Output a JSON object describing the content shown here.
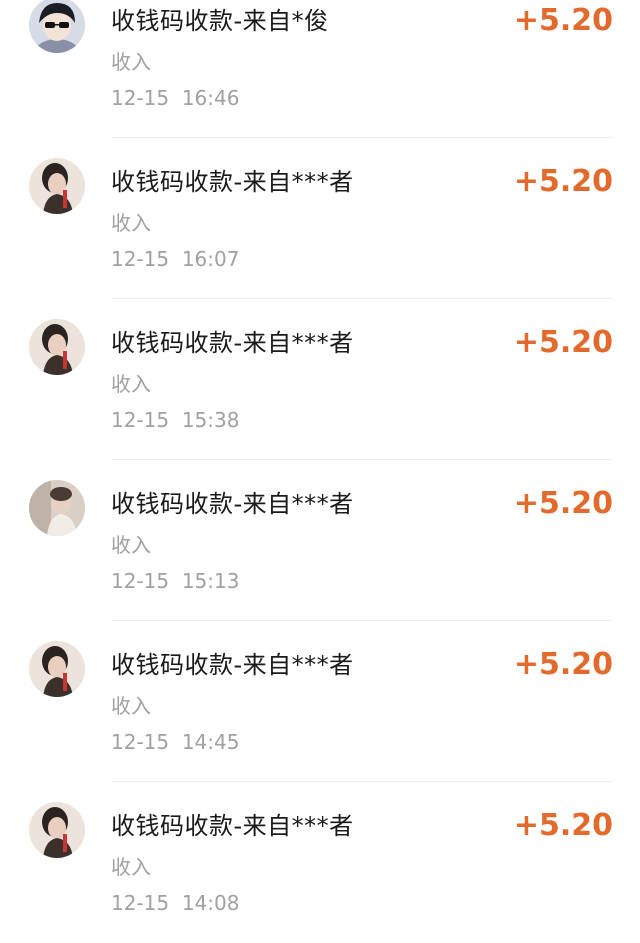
{
  "transactions": [
    {
      "title": "收钱码收款-来自*俊",
      "type": "收入",
      "time": "12-15  16:46",
      "amount": "+5.20",
      "avatar": "anime-boy-avatar"
    },
    {
      "title": "收钱码收款-来自***者",
      "type": "收入",
      "time": "12-15  16:07",
      "amount": "+5.20",
      "avatar": "girl-photo-avatar"
    },
    {
      "title": "收钱码收款-来自***者",
      "type": "收入",
      "time": "12-15  15:38",
      "amount": "+5.20",
      "avatar": "girl-photo-avatar"
    },
    {
      "title": "收钱码收款-来自***者",
      "type": "收入",
      "time": "12-15  15:13",
      "amount": "+5.20",
      "avatar": "photo-avatar"
    },
    {
      "title": "收钱码收款-来自***者",
      "type": "收入",
      "time": "12-15  14:45",
      "amount": "+5.20",
      "avatar": "girl-photo-avatar"
    },
    {
      "title": "收钱码收款-来自***者",
      "type": "收入",
      "time": "12-15  14:08",
      "amount": "+5.20",
      "avatar": "girl-photo-avatar"
    }
  ],
  "colors": {
    "amount": "#e26a2c",
    "title": "#1a1a1a",
    "meta": "#a0a0a0",
    "divider": "#ededed"
  }
}
